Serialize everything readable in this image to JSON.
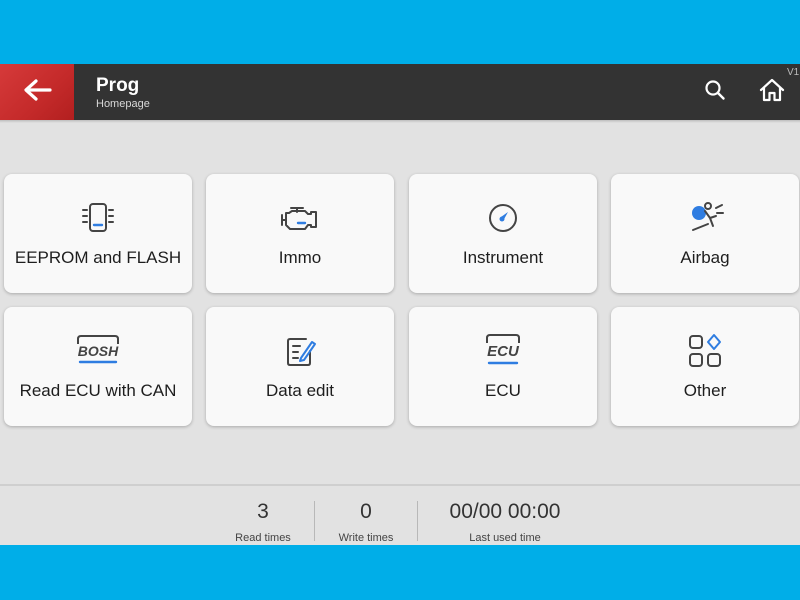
{
  "header": {
    "title": "Prog",
    "subtitle": "Homepage",
    "version": "V1.",
    "back_icon": "arrow-left-icon",
    "search_icon": "search-icon",
    "home_icon": "home-icon"
  },
  "colors": {
    "frame_bg": "#00aee8",
    "header_bg": "#333333",
    "back_button_bg": "#c42a2a",
    "screen_bg": "#e2e2e2",
    "card_bg": "#f9f9f9",
    "icon_accent": "#2f7de1"
  },
  "tiles": [
    {
      "label": "EEPROM and FLASH",
      "icon": "chip-icon"
    },
    {
      "label": "Immo",
      "icon": "engine-icon"
    },
    {
      "label": "Instrument",
      "icon": "gauge-icon"
    },
    {
      "label": "Airbag",
      "icon": "airbag-icon"
    },
    {
      "label": "Read ECU with CAN",
      "icon": "bosh-icon",
      "icon_text": "BOSH"
    },
    {
      "label": "Data edit",
      "icon": "edit-document-icon"
    },
    {
      "label": "ECU",
      "icon": "ecu-icon",
      "icon_text": "ECU"
    },
    {
      "label": "Other",
      "icon": "grid-apps-icon"
    }
  ],
  "footer": {
    "read_times_value": "3",
    "read_times_label": "Read times",
    "write_times_value": "0",
    "write_times_label": "Write times",
    "last_used_value": "00/00 00:00",
    "last_used_label": "Last used time"
  }
}
